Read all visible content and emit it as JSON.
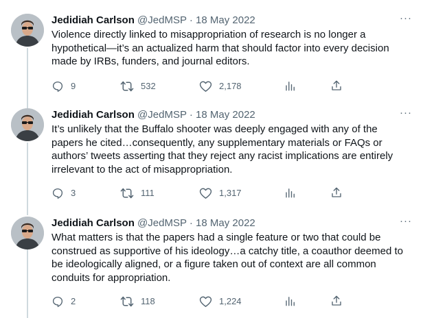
{
  "tweets": [
    {
      "author_name": "Jedidiah Carlson",
      "handle": "@JedMSP",
      "separator": "·",
      "date": "18 May 2022",
      "more_label": "···",
      "text": "Violence directly linked to misappropriation of research is no longer a hypothetical—it’s an actualized harm that should factor into every decision made by IRBs, funders, and journal editors.",
      "replies": "9",
      "retweets": "532",
      "likes": "2,178"
    },
    {
      "author_name": "Jedidiah Carlson",
      "handle": "@JedMSP",
      "separator": "·",
      "date": "18 May 2022",
      "more_label": "···",
      "text": "It’s unlikely that the Buffalo shooter was deeply engaged with any of the papers he cited…consequently, any supplementary materials or FAQs or authors’ tweets asserting that they reject any racist implications are entirely irrelevant to the act of misappropriation.",
      "replies": "3",
      "retweets": "111",
      "likes": "1,317"
    },
    {
      "author_name": "Jedidiah Carlson",
      "handle": "@JedMSP",
      "separator": "·",
      "date": "18 May 2022",
      "more_label": "···",
      "text": "What matters is that the papers had a single feature or two that could be construed as supportive of his ideology…a catchy title, a coauthor deemed to be ideologically aligned, or a figure taken out of context are all common conduits for appropriation.",
      "replies": "2",
      "retweets": "118",
      "likes": "1,224"
    }
  ],
  "colors": {
    "text": "#0f1419",
    "secondary": "#536471",
    "thread_line": "#cfd9de"
  },
  "icons": [
    "reply-icon",
    "retweet-icon",
    "like-icon",
    "analytics-icon",
    "share-icon",
    "more-icon"
  ]
}
